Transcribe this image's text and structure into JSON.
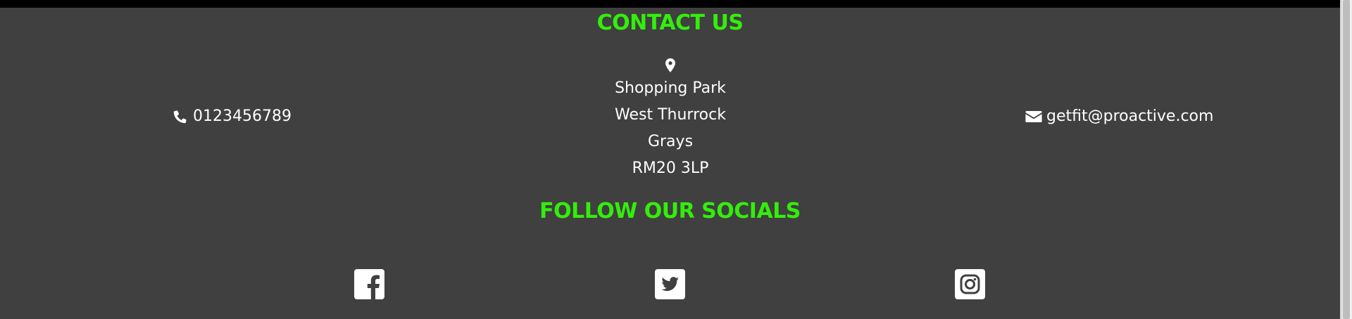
{
  "contact": {
    "heading": "CONTACT US",
    "phone": "0123456789",
    "email": "getfit@proactive.com",
    "address": [
      "Shopping Park",
      "West Thurrock",
      "Grays",
      "RM20 3LP"
    ]
  },
  "socials": {
    "heading": "FOLLOW OUR SOCIALS",
    "icons": [
      "facebook-icon",
      "twitter-icon",
      "instagram-icon"
    ]
  },
  "colors": {
    "background": "#404040",
    "accent": "#33ee0b",
    "text": "#ffffff",
    "topbar": "#000000"
  }
}
